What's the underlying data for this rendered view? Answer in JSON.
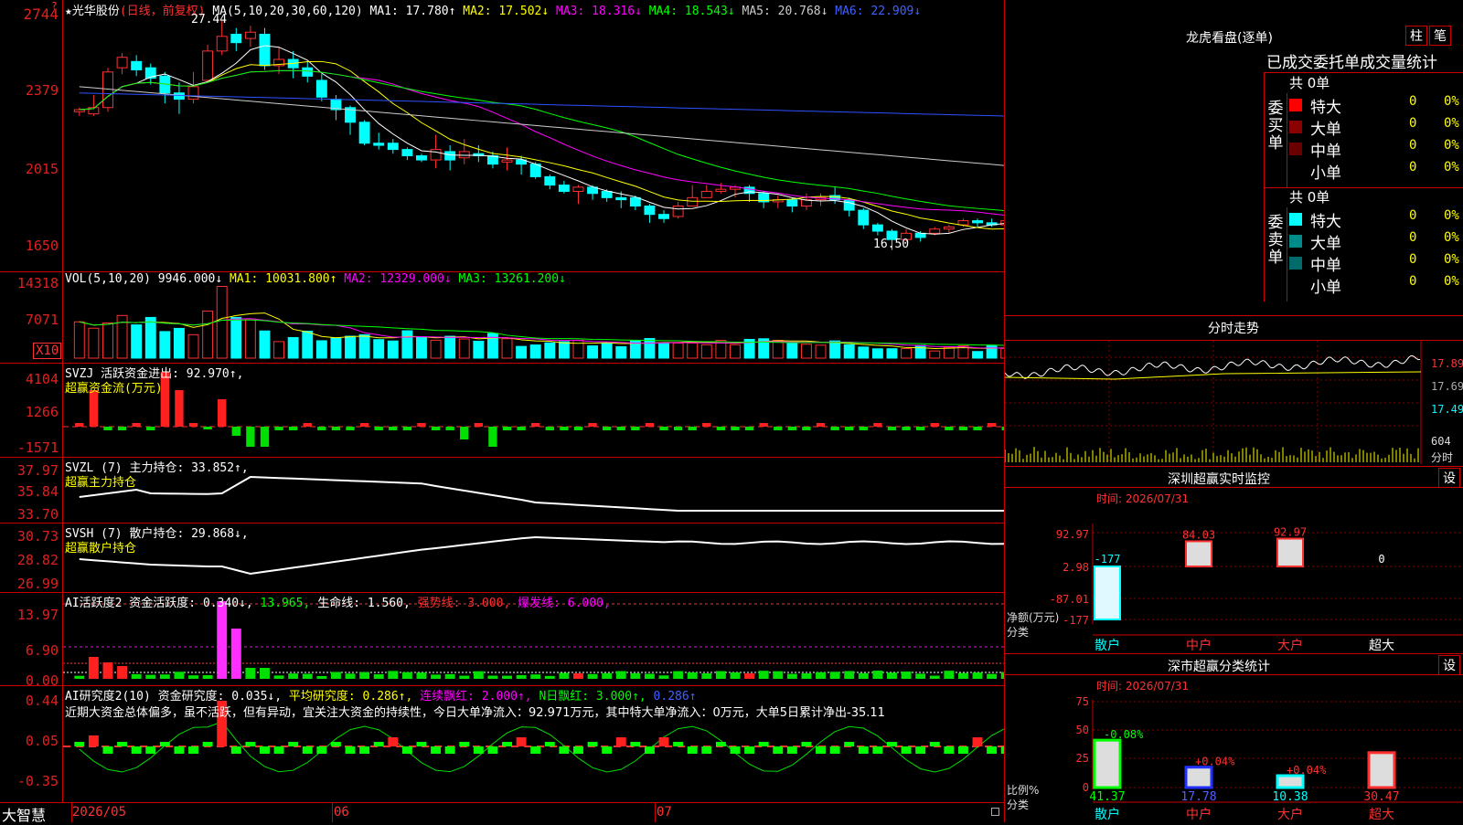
{
  "stock": {
    "name": "★光华股份",
    "mode": "(日线，前复权)"
  },
  "top_left_arrow": "?",
  "main_panel": {
    "ticks": [
      "2744",
      "2379",
      "2015",
      "1650"
    ],
    "ma_items": [
      {
        "text": "MA(5,10,20,30,60,120)",
        "color": "#ffffff"
      },
      {
        "text": "MA1: 17.780↑",
        "color": "#ffffff"
      },
      {
        "text": "MA2: 17.502↓",
        "color": "#ffff00"
      },
      {
        "text": "MA3: 18.316↓",
        "color": "#ff00ff"
      },
      {
        "text": "MA4: 18.543↓",
        "color": "#00ff00"
      },
      {
        "text": "MA5: 20.768↓",
        "color": "#cccccc"
      },
      {
        "text": "MA6: 22.909↓",
        "color": "#4060ff"
      }
    ],
    "high_label": "27.44",
    "low_label": "16.50"
  },
  "vol_panel": {
    "ticks": [
      "14318",
      "7071"
    ],
    "x10": "X10",
    "items": [
      {
        "text": "VOL(5,10,20)",
        "color": "#ffffff"
      },
      {
        "text": "9946.000↓",
        "color": "#ffffff"
      },
      {
        "text": "MA1: 10031.800↑",
        "color": "#ffff00"
      },
      {
        "text": "MA2: 12329.000↓",
        "color": "#ff00ff"
      },
      {
        "text": "MA3: 13261.200↓",
        "color": "#00ff00"
      }
    ]
  },
  "svzj_panel": {
    "ticks": [
      "4104",
      "1266",
      "-1571"
    ],
    "title": "SVZJ  活跃资金进出: 92.970↑,",
    "subtitle": "超赢资金流(万元)"
  },
  "svzl_panel": {
    "ticks": [
      "37.97",
      "35.84",
      "33.70"
    ],
    "title": "SVZL (7) 主力持仓: 33.852↑,",
    "subtitle": "超赢主力持仓"
  },
  "svsh_panel": {
    "ticks": [
      "30.73",
      "28.82",
      "26.99"
    ],
    "title": "SVSH (7) 散户持仓: 29.868↓,",
    "subtitle": "超赢散户持仓"
  },
  "ai_active_panel": {
    "ticks": [
      "13.97",
      "6.90",
      "0.00"
    ],
    "items": [
      {
        "text": "AI活跃度2 资金活跃度: 0.340↓,",
        "color": "#ffffff"
      },
      {
        "text": "13.965,",
        "color": "#00ff00"
      },
      {
        "text": "生命线: 1.560,",
        "color": "#ffffff"
      },
      {
        "text": "强势线: 3.000,",
        "color": "#ff3030"
      },
      {
        "text": "爆发线: 6.000,",
        "color": "#ff00ff"
      }
    ]
  },
  "ai_research_panel": {
    "ticks": [
      "0.44",
      "0.05",
      "-0.35"
    ],
    "items": [
      {
        "text": "AI研究度2(10) 资金研究度: 0.035↓,",
        "color": "#ffffff"
      },
      {
        "text": "平均研究度: 0.286↑,",
        "color": "#ffff00"
      },
      {
        "text": "连续飘红: 2.000↑,",
        "color": "#ff00ff"
      },
      {
        "text": "N日飘红: 3.000↑,",
        "color": "#00ff00"
      },
      {
        "text": "0.286↑",
        "color": "#4060ff"
      }
    ],
    "comment": "近期大资金总体偏多，虽不活跃，但有异动，宜关注大资金的持续性，今日大单净流入：92.971万元，其中特大单净流入：0万元，大单5日累计净出-35.11"
  },
  "bottom": {
    "brand": "大智慧",
    "dates": [
      "2026/05",
      "06",
      "07"
    ]
  },
  "longhu": {
    "title": "龙虎看盘(逐单)",
    "btn1": "柱",
    "btn2": "笔",
    "subtitle": "已成交委托单成交量统计",
    "buy": {
      "label": "委买单",
      "total": "共 0单",
      "rows": [
        {
          "name": "特大",
          "val": "0",
          "pct": "0%",
          "color": "#ff0000"
        },
        {
          "name": "大单",
          "val": "0",
          "pct": "0%",
          "color": "#8b0000"
        },
        {
          "name": "中单",
          "val": "0",
          "pct": "0%",
          "color": "#6b0000"
        },
        {
          "name": "小单",
          "val": "0",
          "pct": "0%",
          "color": ""
        }
      ]
    },
    "sell": {
      "label": "委卖单",
      "total": "共 0单",
      "rows": [
        {
          "name": "特大",
          "val": "0",
          "pct": "0%",
          "color": "#00ffff"
        },
        {
          "name": "大单",
          "val": "0",
          "pct": "0%",
          "color": "#008b8b"
        },
        {
          "name": "中单",
          "val": "0",
          "pct": "0%",
          "color": "#006b6b"
        },
        {
          "name": "小单",
          "val": "0",
          "pct": "0%",
          "color": ""
        }
      ]
    }
  },
  "intraday": {
    "title": "分时走势",
    "ticks": [
      "17.89",
      "17.69",
      "17.49"
    ],
    "vol_tick": "604",
    "vol_label": "分时"
  },
  "sz_monitor": {
    "title": "深圳超赢实时监控",
    "btn": "设",
    "time": "时间: 2026/07/31",
    "ticks": [
      "92.97",
      "2.98",
      "-87.01",
      "-177"
    ],
    "ylabel": "净额(万元)",
    "xlabel": "分类",
    "categories": [
      "散户",
      "中户",
      "大户",
      "超大"
    ],
    "values": [
      -177,
      84.03,
      92.97,
      0
    ],
    "value_labels": [
      "-177",
      "84.03",
      "92.97",
      "0"
    ]
  },
  "sz_stat": {
    "title": "深市超赢分类统计",
    "btn": "设",
    "time": "时间: 2026/07/31",
    "ticks": [
      "75",
      "50",
      "25",
      "0"
    ],
    "ylabel": "比例%",
    "xlabel": "分类",
    "categories": [
      "散户",
      "中户",
      "大户",
      "超大"
    ],
    "values": [
      41.37,
      17.78,
      10.38,
      30.47
    ],
    "changes": [
      "-0.08%",
      "+0.04%",
      "+0.04%",
      ""
    ]
  },
  "chart_data": {
    "type": "candlestick",
    "x_labels": [
      "2026/05",
      "06",
      "07"
    ],
    "ylim": [
      16.5,
      27.44
    ],
    "candles": [
      [
        23.1,
        23.2,
        22.9,
        23.3
      ],
      [
        23.0,
        23.3,
        22.9,
        23.9
      ],
      [
        23.3,
        25.0,
        23.1,
        25.2
      ],
      [
        25.2,
        25.7,
        24.9,
        25.9
      ],
      [
        25.5,
        25.1,
        24.8,
        25.8
      ],
      [
        25.2,
        24.7,
        24.4,
        25.4
      ],
      [
        24.8,
        24.0,
        23.5,
        25.0
      ],
      [
        24.0,
        23.7,
        23.0,
        24.5
      ],
      [
        23.7,
        24.3,
        23.5,
        25.0
      ],
      [
        24.6,
        26.0,
        24.5,
        26.3
      ],
      [
        26.0,
        26.7,
        25.8,
        27.44
      ],
      [
        26.8,
        26.4,
        26.0,
        27.1
      ],
      [
        26.6,
        26.9,
        26.2,
        27.2
      ],
      [
        26.8,
        25.3,
        25.1,
        27.1
      ],
      [
        25.3,
        25.6,
        24.9,
        26.2
      ],
      [
        25.6,
        25.2,
        24.7,
        26.0
      ],
      [
        25.2,
        24.8,
        24.5,
        25.5
      ],
      [
        24.6,
        23.8,
        23.6,
        24.9
      ],
      [
        23.7,
        23.2,
        22.7,
        23.9
      ],
      [
        23.3,
        22.6,
        22.0,
        23.4
      ],
      [
        22.6,
        21.6,
        21.5,
        22.7
      ],
      [
        21.6,
        21.5,
        21.3,
        22.1
      ],
      [
        21.6,
        21.3,
        21.1,
        21.8
      ],
      [
        21.3,
        21.0,
        20.8,
        21.4
      ],
      [
        21.0,
        20.8,
        20.7,
        21.1
      ],
      [
        20.8,
        21.3,
        20.4,
        22.0
      ],
      [
        21.2,
        20.8,
        20.3,
        21.5
      ],
      [
        20.9,
        21.2,
        20.6,
        21.8
      ],
      [
        21.1,
        21.0,
        20.7,
        21.5
      ],
      [
        21.0,
        20.6,
        20.4,
        21.2
      ],
      [
        20.7,
        20.8,
        20.3,
        21.4
      ],
      [
        20.8,
        20.6,
        20.1,
        21.0
      ],
      [
        20.6,
        20.0,
        19.9,
        20.7
      ],
      [
        20.0,
        19.6,
        19.4,
        20.1
      ],
      [
        19.6,
        19.3,
        19.2,
        19.8
      ],
      [
        19.3,
        19.5,
        18.7,
        19.6
      ],
      [
        19.5,
        19.2,
        18.9,
        19.6
      ],
      [
        19.3,
        19.0,
        18.8,
        19.4
      ],
      [
        19.0,
        18.9,
        18.5,
        19.3
      ],
      [
        19.0,
        18.6,
        18.4,
        19.1
      ],
      [
        18.6,
        18.2,
        17.8,
        18.7
      ],
      [
        18.2,
        18.0,
        17.8,
        18.4
      ],
      [
        18.1,
        18.6,
        18.0,
        18.8
      ],
      [
        18.6,
        19.0,
        18.7,
        19.6
      ],
      [
        19.0,
        19.3,
        19.1,
        19.6
      ],
      [
        19.3,
        19.4,
        19.2,
        19.7
      ],
      [
        19.4,
        19.5,
        19.0,
        19.6
      ],
      [
        19.5,
        19.2,
        18.8,
        19.6
      ],
      [
        19.2,
        18.8,
        18.5,
        19.3
      ],
      [
        18.8,
        18.9,
        18.5,
        19.1
      ],
      [
        18.9,
        18.6,
        18.3,
        19.0
      ],
      [
        18.6,
        18.9,
        18.4,
        19.2
      ],
      [
        18.9,
        19.0,
        18.6,
        19.2
      ],
      [
        19.1,
        18.9,
        18.7,
        19.5
      ],
      [
        18.9,
        18.4,
        18.1,
        19.0
      ],
      [
        18.4,
        17.7,
        17.5,
        18.5
      ],
      [
        17.7,
        17.4,
        17.2,
        17.8
      ],
      [
        17.4,
        17.0,
        16.5,
        17.5
      ],
      [
        17.0,
        17.3,
        16.9,
        17.5
      ],
      [
        17.3,
        17.1,
        16.9,
        17.4
      ],
      [
        17.3,
        17.5,
        17.2,
        17.6
      ],
      [
        17.5,
        17.6,
        17.3,
        17.7
      ],
      [
        17.7,
        17.9,
        17.6,
        18.0
      ],
      [
        17.9,
        17.8,
        17.6,
        18.0
      ],
      [
        17.8,
        17.7,
        17.6,
        18.0
      ],
      [
        17.7,
        17.9,
        17.6,
        18.0
      ]
    ]
  }
}
